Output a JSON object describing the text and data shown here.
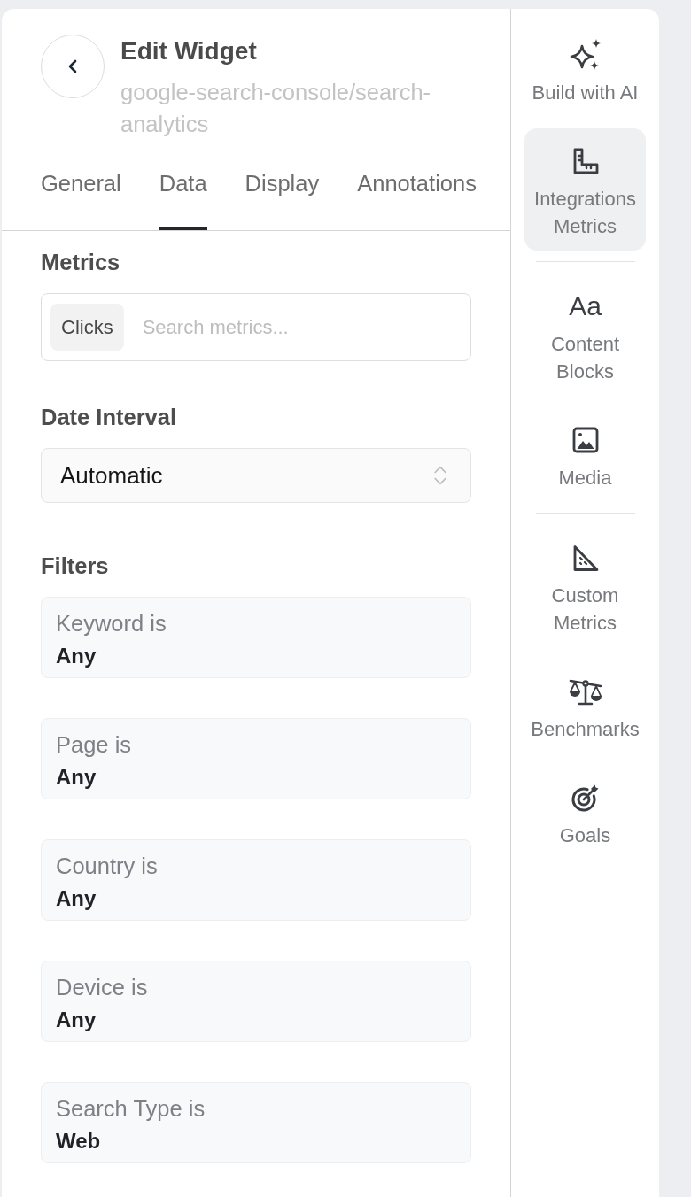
{
  "header": {
    "title": "Edit Widget",
    "subtitle": "google-search-console/search-analytics"
  },
  "tabs": [
    {
      "label": "General",
      "selected": false
    },
    {
      "label": "Data",
      "selected": true
    },
    {
      "label": "Display",
      "selected": false
    },
    {
      "label": "Annotations",
      "selected": false
    }
  ],
  "metrics": {
    "label": "Metrics",
    "chips": [
      "Clicks"
    ],
    "placeholder": "Search metrics..."
  },
  "date_interval": {
    "label": "Date Interval",
    "value": "Automatic"
  },
  "filters": {
    "label": "Filters",
    "items": [
      {
        "label": "Keyword is",
        "value": "Any"
      },
      {
        "label": "Page is",
        "value": "Any"
      },
      {
        "label": "Country is",
        "value": "Any"
      },
      {
        "label": "Device is",
        "value": "Any"
      },
      {
        "label": "Search Type is",
        "value": "Web"
      }
    ]
  },
  "sidebar": {
    "groups": [
      {
        "items": [
          {
            "label": "Build with AI",
            "selected": false
          },
          {
            "label": "Integrations Metrics",
            "selected": true
          }
        ]
      },
      {
        "items": [
          {
            "label": "Content Blocks",
            "selected": false,
            "glyph": "Aa"
          },
          {
            "label": "Media",
            "selected": false
          }
        ]
      },
      {
        "items": [
          {
            "label": "Custom Metrics",
            "selected": false
          },
          {
            "label": "Benchmarks",
            "selected": false
          },
          {
            "label": "Goals",
            "selected": false
          }
        ]
      }
    ]
  }
}
